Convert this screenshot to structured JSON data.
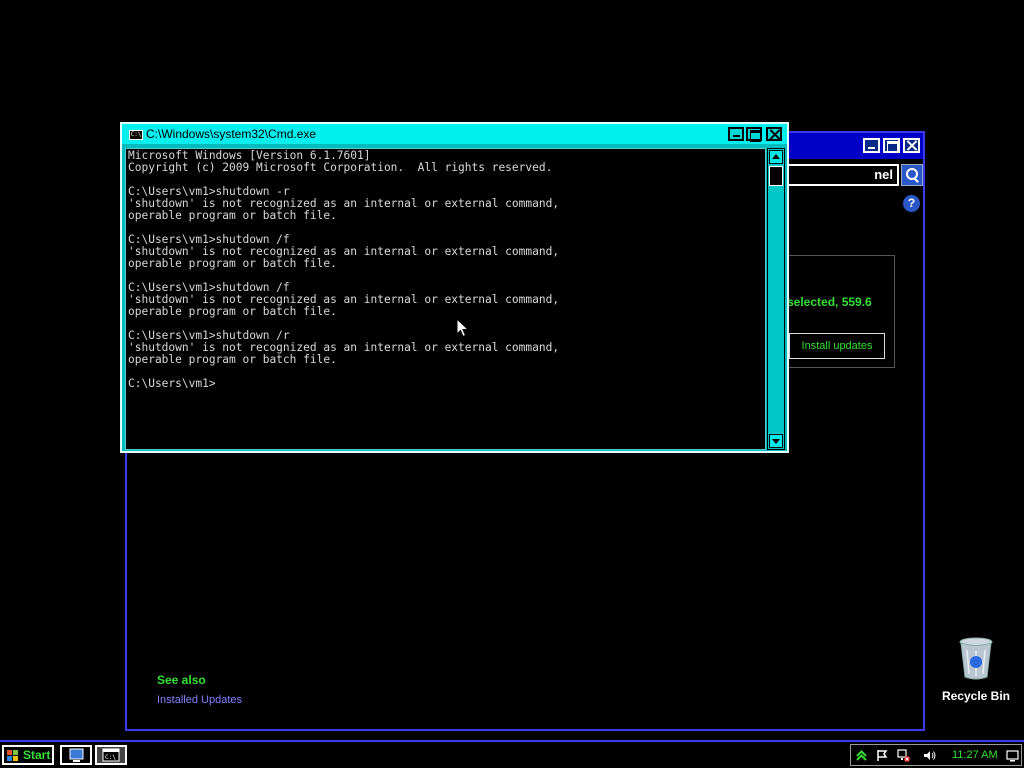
{
  "background_window": {
    "search_text": "nel",
    "help_label": "?",
    "info_text": "selected, 559.6",
    "install_button": "Install updates",
    "see_also": "See also",
    "installed_updates_link": "Installed Updates"
  },
  "cmd_window": {
    "title": "C:\\Windows\\system32\\Cmd.exe",
    "icon_text": "C:\\",
    "console_text": "Microsoft Windows [Version 6.1.7601]\nCopyright (c) 2009 Microsoft Corporation.  All rights reserved.\n\nC:\\Users\\vm1>shutdown -r\n'shutdown' is not recognized as an internal or external command,\noperable program or batch file.\n\nC:\\Users\\vm1>shutdown /f\n'shutdown' is not recognized as an internal or external command,\noperable program or batch file.\n\nC:\\Users\\vm1>shutdown /f\n'shutdown' is not recognized as an internal or external command,\noperable program or batch file.\n\nC:\\Users\\vm1>shutdown /r\n'shutdown' is not recognized as an internal or external command,\noperable program or batch file.\n\nC:\\Users\\vm1>"
  },
  "desktop": {
    "recycle_bin_label": "Recycle Bin"
  },
  "taskbar": {
    "start_label": "Start",
    "clock": "11:27 AM",
    "buttons": [
      "control-panel",
      "cmd"
    ]
  },
  "colors": {
    "accent_green": "#33e033",
    "cmd_frame": "#00bcbc",
    "window_border": "#3a3af0"
  }
}
